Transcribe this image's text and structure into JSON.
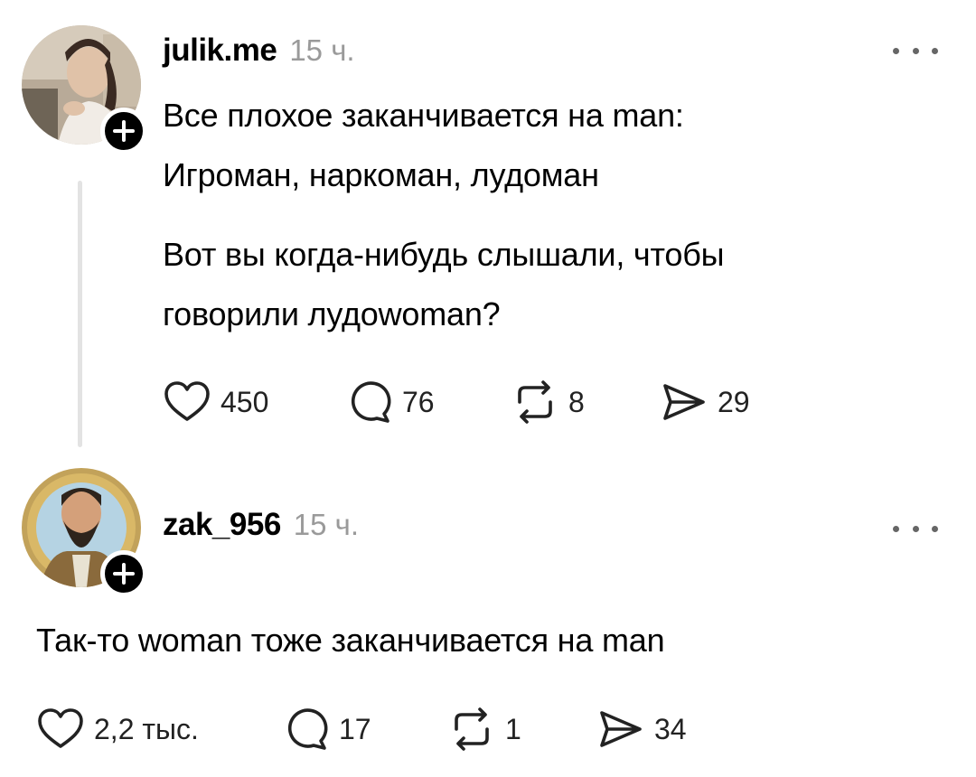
{
  "posts": [
    {
      "username": "julik.me",
      "time": "15 ч.",
      "lines": [
        "Все плохое заканчивается на man:",
        "Игроман, наркоман, лудоман",
        "Вот вы когда-нибудь слышали, чтобы",
        "говорили лудоwoman?"
      ],
      "stats": {
        "likes": "450",
        "replies": "76",
        "reposts": "8",
        "shares": "29"
      }
    },
    {
      "username": "zak_956",
      "time": "15 ч.",
      "lines": [
        "Так-то woman тоже заканчивается на man"
      ],
      "stats": {
        "likes": "2,2 тыс.",
        "replies": "17",
        "reposts": "1",
        "shares": "34"
      }
    }
  ],
  "icons": {
    "like": "heart-icon",
    "reply": "speech-bubble-icon",
    "repost": "repost-arrows-icon",
    "share": "paper-plane-icon",
    "more": "more-dots-icon",
    "follow": "plus-icon"
  },
  "colors": {
    "text": "#000000",
    "muted": "#9a9a9a",
    "thread_line": "#e3e3e3",
    "icon": "#222222"
  }
}
